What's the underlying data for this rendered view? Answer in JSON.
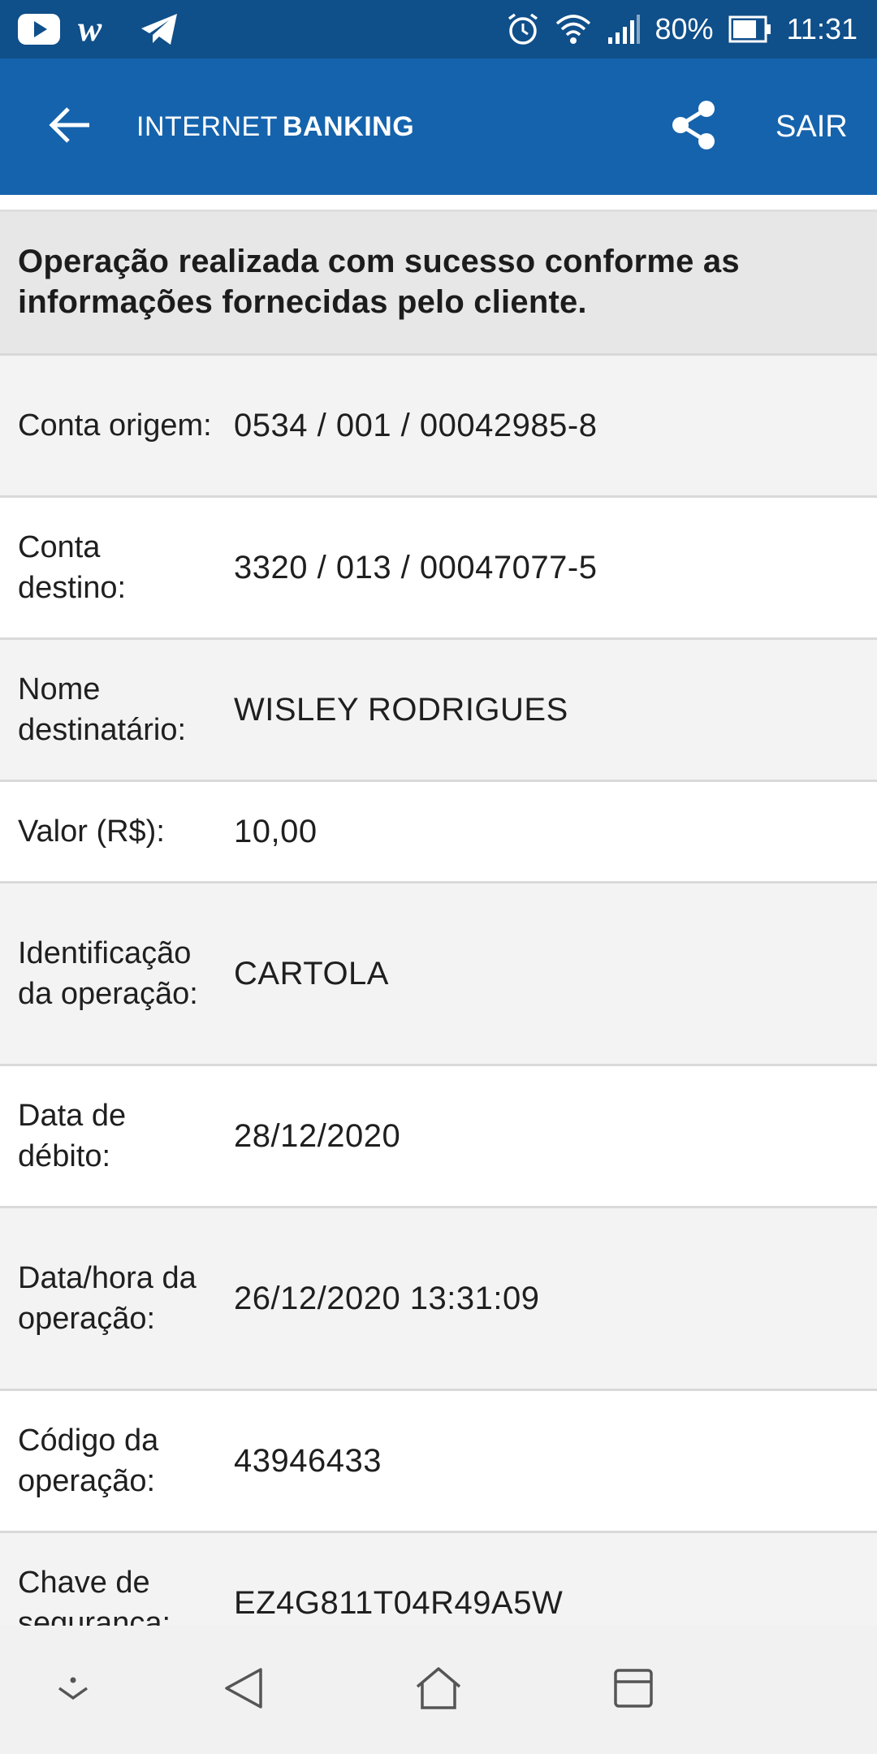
{
  "status_bar": {
    "left_icons": [
      "youtube-icon",
      "w-app-icon",
      "telegram-icon"
    ],
    "right_icons": [
      "alarm-icon",
      "wifi-icon",
      "signal-icon"
    ],
    "battery": "80%",
    "time": "11:31"
  },
  "app_bar": {
    "title_regular": "INTERNET",
    "title_bold": "BANKING",
    "logout_label": "SAIR",
    "background_color": "#1563ad"
  },
  "receipt": {
    "message": "Operação realizada com sucesso conforme as informações fornecidas pelo cliente.",
    "rows": [
      {
        "label": "Conta origem:",
        "value": "0534 / 001 / 00042985-8"
      },
      {
        "label": "Conta destino:",
        "value": "3320 / 013 / 00047077-5"
      },
      {
        "label": "Nome destinatário:",
        "value": "WISLEY RODRIGUES"
      },
      {
        "label": "Valor (R$):",
        "value": "10,00"
      },
      {
        "label": "Identificação da operação:",
        "value": "CARTOLA"
      },
      {
        "label": "Data de débito:",
        "value": "28/12/2020"
      },
      {
        "label": "Data/hora da operação:",
        "value": "26/12/2020 13:31:09"
      },
      {
        "label": "Código da operação:",
        "value": "43946433"
      },
      {
        "label": "Chave de segurança:",
        "value": "EZ4G811T04R49A5W"
      }
    ]
  },
  "nav_bar": {
    "buttons": [
      "collapse-icon",
      "back-triangle-icon",
      "home-icon",
      "recents-icon"
    ]
  }
}
